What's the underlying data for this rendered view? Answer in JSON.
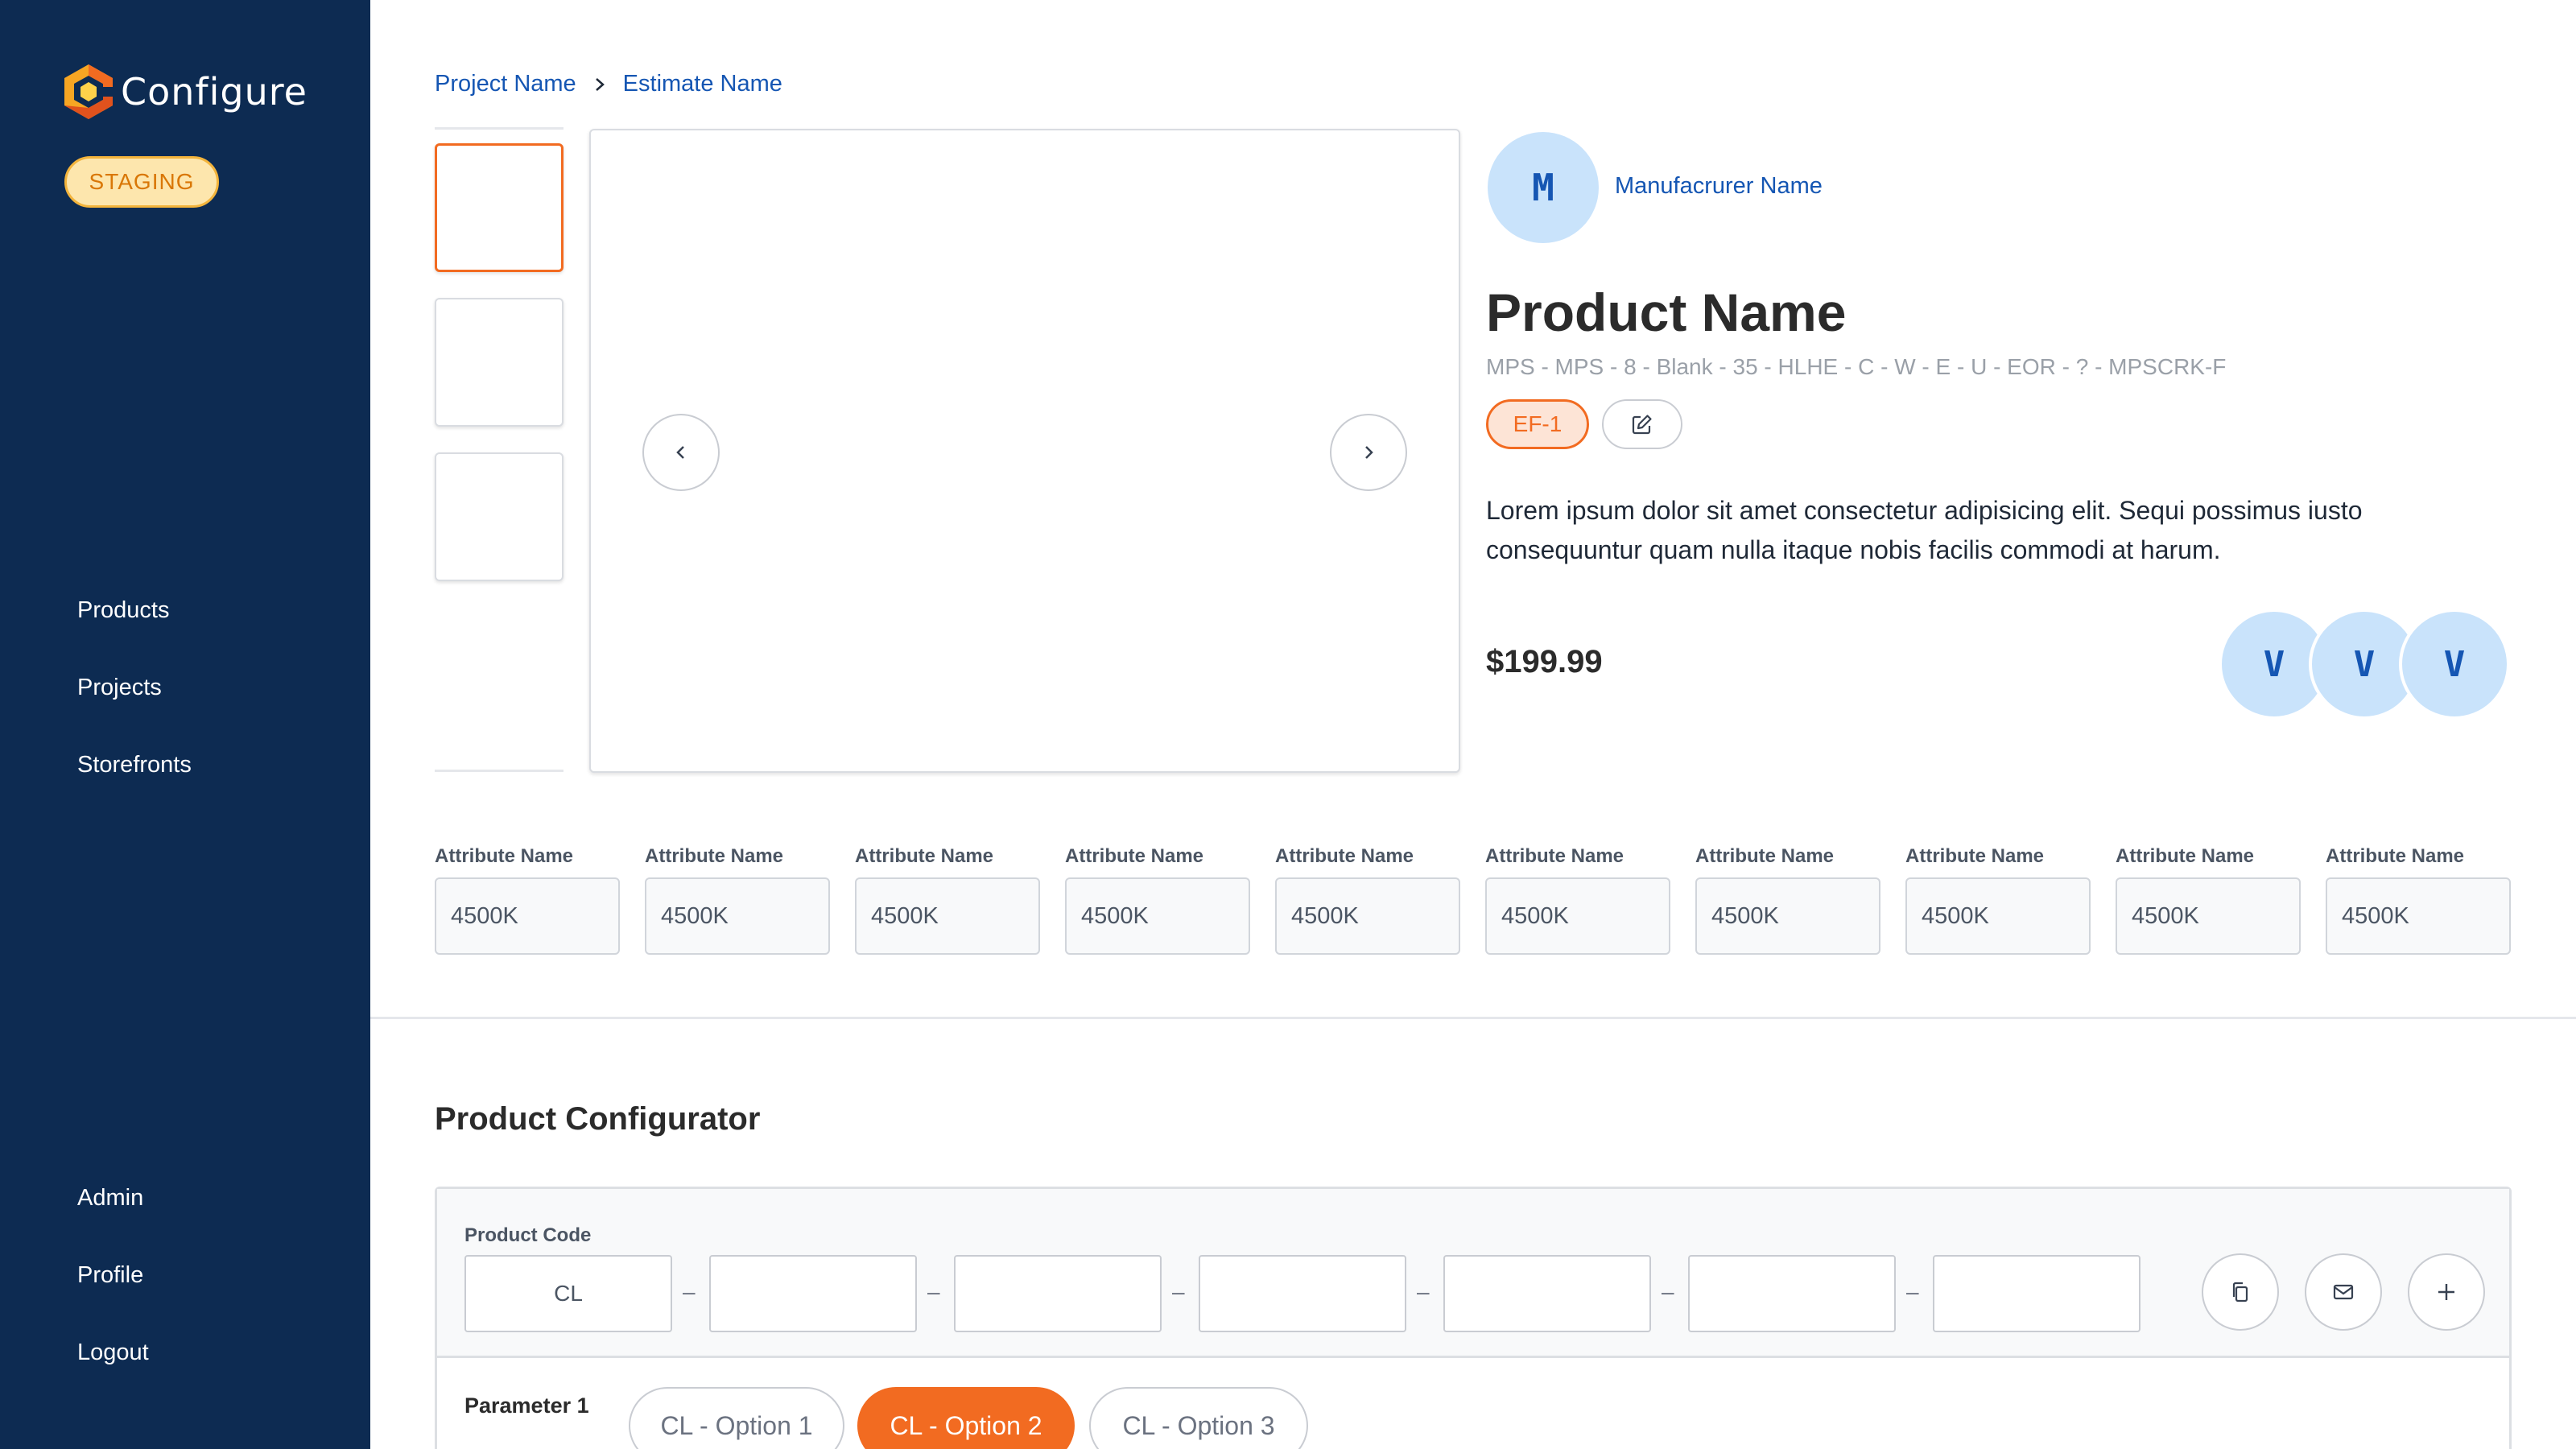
{
  "app": {
    "name": "Configure",
    "environment": "STAGING"
  },
  "sidebar": {
    "nav_top": [
      {
        "label": "Products"
      },
      {
        "label": "Projects"
      },
      {
        "label": "Storefronts"
      }
    ],
    "nav_bottom": [
      {
        "label": "Admin"
      },
      {
        "label": "Profile"
      },
      {
        "label": "Logout"
      }
    ]
  },
  "breadcrumb": {
    "project": "Project Name",
    "estimate": "Estimate Name"
  },
  "manufacturer": {
    "initial": "M",
    "name": "Manufacrurer Name"
  },
  "product": {
    "name": "Product Name",
    "code_line": "MPS - MPS - 8 - Blank - 35 - HLHE - C - W - E - U - EOR - ? - MPSCRK-F",
    "tag": "EF-1",
    "description": "Lorem ipsum dolor sit amet consectetur adipisicing elit. Sequi possimus iusto consequuntur quam nulla itaque nobis facilis commodi at harum.",
    "price": "$199.99",
    "variants": [
      "V",
      "V",
      "V"
    ]
  },
  "attributes": [
    {
      "label": "Attribute Name",
      "value": "4500K"
    },
    {
      "label": "Attribute Name",
      "value": "4500K"
    },
    {
      "label": "Attribute Name",
      "value": "4500K"
    },
    {
      "label": "Attribute Name",
      "value": "4500K"
    },
    {
      "label": "Attribute Name",
      "value": "4500K"
    },
    {
      "label": "Attribute Name",
      "value": "4500K"
    },
    {
      "label": "Attribute Name",
      "value": "4500K"
    },
    {
      "label": "Attribute Name",
      "value": "4500K"
    },
    {
      "label": "Attribute Name",
      "value": "4500K"
    },
    {
      "label": "Attribute Name",
      "value": "4500K"
    }
  ],
  "configurator": {
    "title": "Product Configurator",
    "product_code_label": "Product Code",
    "code_segments": [
      "CL",
      "",
      "",
      "",
      "",
      "",
      ""
    ],
    "separator": "–",
    "parameter": {
      "label": "Parameter 1",
      "options": [
        "CL - Option 1",
        "CL - Option 2",
        "CL - Option 3"
      ],
      "selected": "CL - Option 2"
    }
  },
  "colors": {
    "sidebar_bg": "#0d2b52",
    "accent": "#f26b21",
    "link": "#1556b3",
    "avatar_bg": "#c9e3fb",
    "staging_bg": "#fde6ad"
  }
}
